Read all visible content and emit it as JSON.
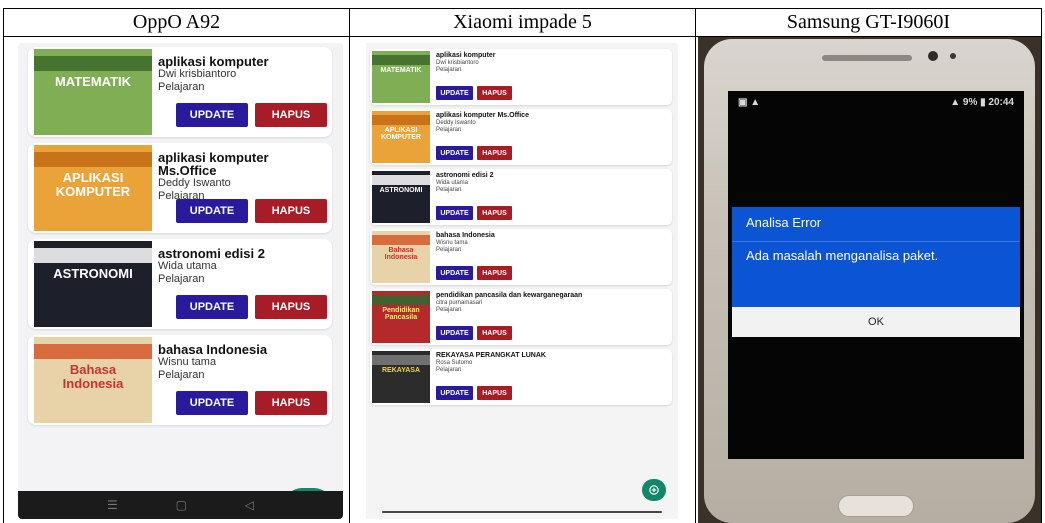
{
  "columns": [
    {
      "device": "OppO A92"
    },
    {
      "device": "Xiaomi impade 5"
    },
    {
      "device": "Samsung GT-I9060I"
    }
  ],
  "oppo": {
    "books": [
      {
        "title": "aplikasi komputer",
        "author": "Dwi krisbiantoro",
        "category": "Pelajaran",
        "cover": "MATEMATIK"
      },
      {
        "title": "aplikasi komputer Ms.Office",
        "author": "Deddy Iswanto",
        "category": "Pelajaran",
        "cover": "APLIKASI KOMPUTER"
      },
      {
        "title": "astronomi edisi 2",
        "author": "Wida utama",
        "category": "Pelajaran",
        "cover": "ASTRONOMI"
      },
      {
        "title": "bahasa Indonesia",
        "author": "Wisnu tama",
        "category": "Pelajaran",
        "cover": "Bahasa Indonesia"
      }
    ],
    "update_label": "UPDATE",
    "delete_label": "HAPUS"
  },
  "xiaomi": {
    "books": [
      {
        "title": "aplikasi komputer",
        "author": "Dwi krisbiantoro",
        "category": "Pelajaran",
        "cover": "MATEMATIK"
      },
      {
        "title": "aplikasi komputer Ms.Office",
        "author": "Deddy Iswanto",
        "category": "Pelajaran",
        "cover": "APLIKASI KOMPUTER"
      },
      {
        "title": "astronomi edisi 2",
        "author": "Wida utama",
        "category": "Pelajaran",
        "cover": "ASTRONOMI"
      },
      {
        "title": "bahasa Indonesia",
        "author": "Wisnu tama",
        "category": "Pelajaran",
        "cover": "Bahasa Indonesia"
      },
      {
        "title": "pendidikan pancasila dan kewarganegaraan",
        "author": "citra purnamasari",
        "category": "Pelajaran",
        "cover": "Pendidikan Pancasila"
      },
      {
        "title": "REKAYASA PERANGKAT LUNAK",
        "author": "Rosa Sutomo",
        "category": "Pelajaran",
        "cover": "REKAYASA"
      }
    ],
    "update_label": "UPDATE",
    "delete_label": "HAPUS"
  },
  "samsung": {
    "status_time": "20:44",
    "battery": "9%",
    "dialog_title": "Analisa Error",
    "dialog_message": "Ada masalah menganalisa paket.",
    "ok_label": "OK"
  },
  "colors": {
    "update_button": "#2a1a9c",
    "delete_button": "#a81c26",
    "fab": "#11886b",
    "dialog": "#0b54d4"
  },
  "icons": [
    "plus-circle-icon",
    "home-nav-icon",
    "back-nav-icon",
    "menu-nav-icon",
    "signal-icon",
    "wifi-icon",
    "battery-icon"
  ]
}
